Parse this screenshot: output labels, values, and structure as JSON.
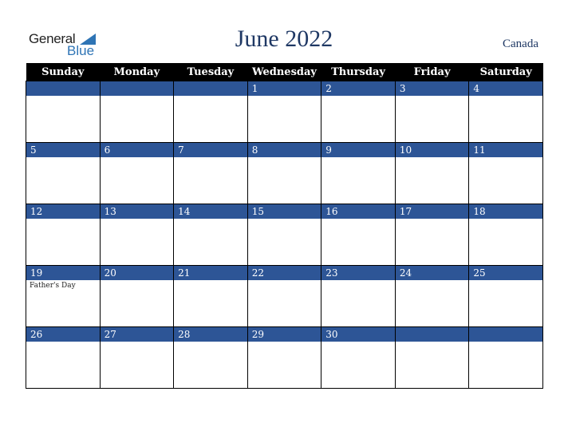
{
  "logo": {
    "general": "General",
    "blue": "Blue"
  },
  "title": "June 2022",
  "country": "Canada",
  "weekdays": [
    "Sunday",
    "Monday",
    "Tuesday",
    "Wednesday",
    "Thursday",
    "Friday",
    "Saturday"
  ],
  "weeks": [
    [
      {
        "day": ""
      },
      {
        "day": ""
      },
      {
        "day": ""
      },
      {
        "day": "1"
      },
      {
        "day": "2"
      },
      {
        "day": "3"
      },
      {
        "day": "4"
      }
    ],
    [
      {
        "day": "5"
      },
      {
        "day": "6"
      },
      {
        "day": "7"
      },
      {
        "day": "8"
      },
      {
        "day": "9"
      },
      {
        "day": "10"
      },
      {
        "day": "11"
      }
    ],
    [
      {
        "day": "12"
      },
      {
        "day": "13"
      },
      {
        "day": "14"
      },
      {
        "day": "15"
      },
      {
        "day": "16"
      },
      {
        "day": "17"
      },
      {
        "day": "18"
      }
    ],
    [
      {
        "day": "19",
        "holiday": "Father's Day"
      },
      {
        "day": "20"
      },
      {
        "day": "21"
      },
      {
        "day": "22"
      },
      {
        "day": "23"
      },
      {
        "day": "24"
      },
      {
        "day": "25"
      }
    ],
    [
      {
        "day": "26"
      },
      {
        "day": "27"
      },
      {
        "day": "28"
      },
      {
        "day": "29"
      },
      {
        "day": "30"
      },
      {
        "day": ""
      },
      {
        "day": ""
      }
    ]
  ]
}
